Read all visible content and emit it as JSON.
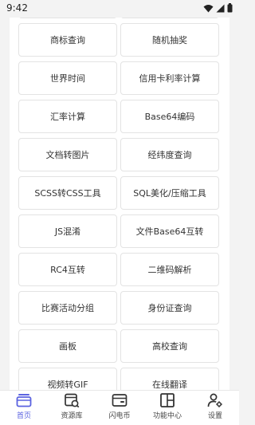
{
  "status_bar": {
    "time": "9:42"
  },
  "tools": [
    "商标查询",
    "随机抽奖",
    "世界时间",
    "信用卡利率计算",
    "汇率计算",
    "Base64编码",
    "文档转图片",
    "经纬度查询",
    "SCSS转CSS工具",
    "SQL美化/压缩工具",
    "JS混淆",
    "文件Base64互转",
    "RC4互转",
    "二维码解析",
    "比赛活动分组",
    "身份证查询",
    "画板",
    "高校查询",
    "视频转GIF",
    "在线翻译"
  ],
  "tab_bar": {
    "accent_color": "#5b63e0",
    "items": [
      {
        "label": "首页",
        "icon": "home-icon",
        "active": true
      },
      {
        "label": "资源库",
        "icon": "resource-icon",
        "active": false
      },
      {
        "label": "闪电币",
        "icon": "wallet-icon",
        "active": false
      },
      {
        "label": "功能中心",
        "icon": "grid-icon",
        "active": false
      },
      {
        "label": "设置",
        "icon": "settings-icon",
        "active": false
      }
    ]
  }
}
